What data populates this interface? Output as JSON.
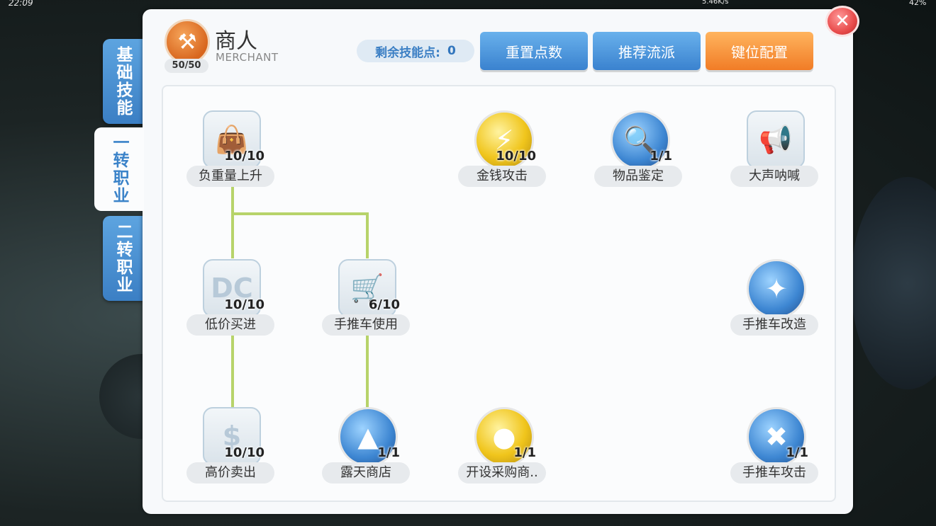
{
  "status": {
    "time": "22:09",
    "net": "5.46K/s",
    "battery": "42%"
  },
  "tabs": [
    {
      "label": "基础技能",
      "active": false
    },
    {
      "label": "一转职业",
      "active": true
    },
    {
      "label": "二转职业",
      "active": false
    }
  ],
  "job": {
    "emblem": "merchant-axe-icon",
    "title": "商人",
    "subtitle": "MERCHANT",
    "level": "50/50"
  },
  "skill_points": {
    "label": "剩余技能点:",
    "value": "0"
  },
  "buttons": {
    "reset": "重置点数",
    "recommend": "推荐流派",
    "keymap": "键位配置"
  },
  "colors": {
    "accent_blue": "#3b7fc4",
    "accent_orange": "#f17c26",
    "connector": "#b7d36a"
  },
  "skills": [
    {
      "id": "weight",
      "name": "负重量上升",
      "level": "10/10",
      "icon": "bag-icon"
    },
    {
      "id": "money",
      "name": "金钱攻击",
      "level": "10/10",
      "icon": "gold-coin-icon"
    },
    {
      "id": "identify",
      "name": "物品鉴定",
      "level": "1/1",
      "icon": "magnifier-icon"
    },
    {
      "id": "shout",
      "name": "大声呐喊",
      "level": "",
      "icon": "shout-icon"
    },
    {
      "id": "discount",
      "name": "低价买进",
      "level": "10/10",
      "icon": "dc-icon"
    },
    {
      "id": "cart",
      "name": "手推车使用",
      "level": "6/10",
      "icon": "cart-icon"
    },
    {
      "id": "cartmod",
      "name": "手推车改造",
      "level": "",
      "icon": "cart-sparkle-icon"
    },
    {
      "id": "overcharge",
      "name": "高价卖出",
      "level": "10/10",
      "icon": "dollar-icon"
    },
    {
      "id": "vending",
      "name": "露天商店",
      "level": "1/1",
      "icon": "tent-icon"
    },
    {
      "id": "buying",
      "name": "开设采购商..",
      "level": "1/1",
      "icon": "coins-icon"
    },
    {
      "id": "cartattack",
      "name": "手推车攻击",
      "level": "1/1",
      "icon": "cart-attack-icon"
    }
  ]
}
